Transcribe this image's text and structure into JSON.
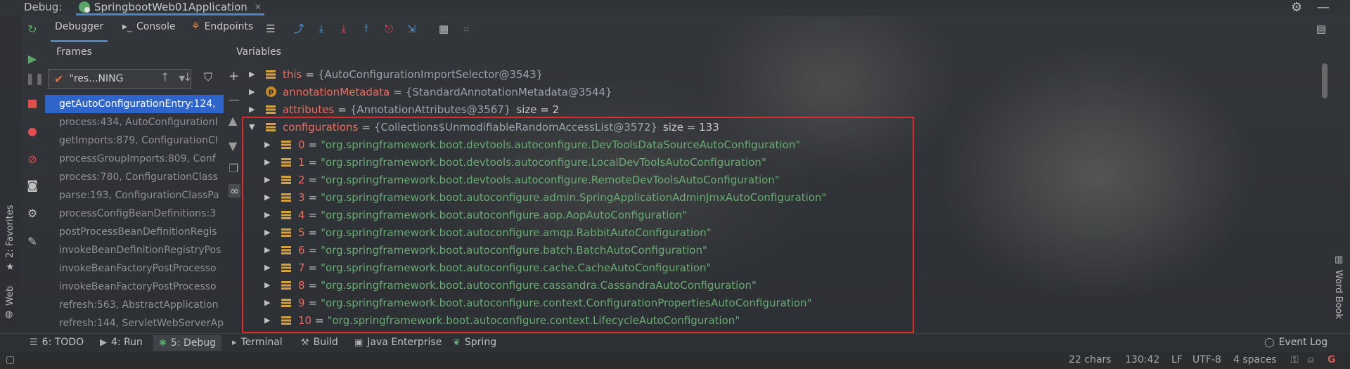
{
  "titlebar": {
    "debug_label": "Debug:",
    "run_tab": "SpringbootWeb01Application"
  },
  "left_strip": {
    "favorites": "2: Favorites",
    "web": "Web"
  },
  "toolbar": {
    "tabs": [
      "Debugger",
      "Console",
      "Endpoints"
    ]
  },
  "frames": {
    "title": "Frames",
    "thread": "\"res...NING",
    "items": [
      "getAutoConfigurationEntry:124,",
      "process:434, AutoConfigurationI",
      "getImports:879, ConfigurationCl",
      "processGroupImports:809, Conf",
      "process:780, ConfigurationClass",
      "parse:193, ConfigurationClassPa",
      "processConfigBeanDefinitions:3",
      "postProcessBeanDefinitionRegis",
      "invokeBeanDefinitionRegistryPos",
      "invokeBeanFactoryPostProcesso",
      "invokeBeanFactoryPostProcesso",
      "refresh:563, AbstractApplication",
      "refresh:144, ServletWebServerAp"
    ]
  },
  "variables": {
    "title": "Variables",
    "rows": [
      {
        "name": "this",
        "value": "{AutoConfigurationImportSelector@3543}",
        "size": ""
      },
      {
        "name": "annotationMetadata",
        "value": "{StandardAnnotationMetadata@3544}",
        "size": ""
      },
      {
        "name": "attributes",
        "value": "{AnnotationAttributes@3567}",
        "size": "size = 2"
      },
      {
        "name": "configurations",
        "value": "{Collections$UnmodifiableRandomAccessList@3572}",
        "size": "size = 133"
      }
    ],
    "config_items": [
      {
        "index": "0",
        "value": "\"org.springframework.boot.devtools.autoconfigure.DevToolsDataSourceAutoConfiguration\""
      },
      {
        "index": "1",
        "value": "\"org.springframework.boot.devtools.autoconfigure.LocalDevToolsAutoConfiguration\""
      },
      {
        "index": "2",
        "value": "\"org.springframework.boot.devtools.autoconfigure.RemoteDevToolsAutoConfiguration\""
      },
      {
        "index": "3",
        "value": "\"org.springframework.boot.autoconfigure.admin.SpringApplicationAdminJmxAutoConfiguration\""
      },
      {
        "index": "4",
        "value": "\"org.springframework.boot.autoconfigure.aop.AopAutoConfiguration\""
      },
      {
        "index": "5",
        "value": "\"org.springframework.boot.autoconfigure.amqp.RabbitAutoConfiguration\""
      },
      {
        "index": "6",
        "value": "\"org.springframework.boot.autoconfigure.batch.BatchAutoConfiguration\""
      },
      {
        "index": "7",
        "value": "\"org.springframework.boot.autoconfigure.cache.CacheAutoConfiguration\""
      },
      {
        "index": "8",
        "value": "\"org.springframework.boot.autoconfigure.cassandra.CassandraAutoConfiguration\""
      },
      {
        "index": "9",
        "value": "\"org.springframework.boot.autoconfigure.context.ConfigurationPropertiesAutoConfiguration\""
      },
      {
        "index": "10",
        "value": "\"org.springframework.boot.autoconfigure.context.LifecycleAutoConfiguration\""
      }
    ]
  },
  "right_strip": {
    "word_book": "Word Book"
  },
  "bottom_tabs": {
    "todo": "6: TODO",
    "run": "4: Run",
    "debug": "5: Debug",
    "terminal": "Terminal",
    "build": "Build",
    "java_enterprise": "Java Enterprise",
    "spring": "Spring",
    "event_log": "Event Log"
  },
  "status": {
    "chars": "22 chars",
    "position": "130:42",
    "line_sep": "LF",
    "encoding": "UTF-8",
    "indent": "4 spaces"
  }
}
